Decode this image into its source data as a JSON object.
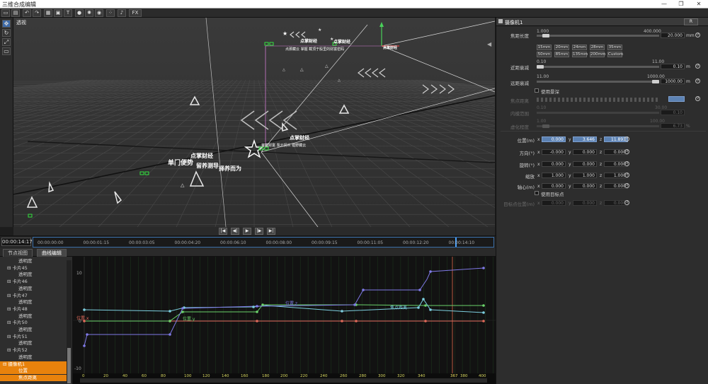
{
  "window": {
    "title": "三维合成编辑",
    "minimize": "—",
    "maximize": "❐",
    "close": "✕"
  },
  "toolbar": {
    "fx_label": "FX"
  },
  "viewport": {
    "label": "透视",
    "texts": [
      "点掌财经",
      "点掌财经",
      "单门便势",
      "留养测导",
      "择养而为",
      "点掌财经",
      "点掌财经",
      "点掌财经"
    ],
    "bg_color": "#303030"
  },
  "playback": {
    "buttons": [
      "|◀",
      "◀|",
      "▶",
      "|▶",
      "▶|"
    ]
  },
  "timeline": {
    "current_time": "00:00:14:17",
    "ticks": [
      "00:00:00:00",
      "00:00:01:15",
      "00:00:03:05",
      "00:00:04:20",
      "00:00:06:10",
      "00:00:08:00",
      "00:00:09:15",
      "00:00:11:05",
      "00:00:12:20",
      "00:00:14:10"
    ]
  },
  "tabs": [
    "节点视图",
    "曲线编辑"
  ],
  "tree": {
    "items": [
      {
        "label": "透明度",
        "indent": 2
      },
      {
        "label": "卡片45",
        "indent": 1
      },
      {
        "label": "透明度",
        "indent": 2
      },
      {
        "label": "卡片46",
        "indent": 1
      },
      {
        "label": "透明度",
        "indent": 2
      },
      {
        "label": "卡片47",
        "indent": 1
      },
      {
        "label": "透明度",
        "indent": 2
      },
      {
        "label": "卡片48",
        "indent": 1
      },
      {
        "label": "透明度",
        "indent": 2
      },
      {
        "label": "卡片50",
        "indent": 1
      },
      {
        "label": "透明度",
        "indent": 2
      },
      {
        "label": "卡片51",
        "indent": 1
      },
      {
        "label": "透明度",
        "indent": 2
      },
      {
        "label": "卡片52",
        "indent": 1
      },
      {
        "label": "透明度",
        "indent": 2
      },
      {
        "label": "摄像机1",
        "indent": 0,
        "selected": true
      },
      {
        "label": "位置",
        "indent": 2,
        "selected": true
      },
      {
        "label": "焦点距离",
        "indent": 2,
        "selected": true
      }
    ]
  },
  "graph": {
    "y_labels": [
      "10",
      "0",
      "-10"
    ],
    "x_labels": [
      "0",
      "20",
      "40",
      "60",
      "80",
      "100",
      "120",
      "140",
      "160",
      "180",
      "200",
      "220",
      "240",
      "260",
      "280",
      "300",
      "320",
      "340",
      "367",
      "380",
      "400"
    ],
    "playhead_label": "367",
    "curve_labels": [
      "位置.x",
      "位置.y",
      "位置.z",
      "焦点距离"
    ],
    "colors": {
      "x": "#e06a5a",
      "y": "#6bd36b",
      "z": "#7f79e6",
      "focus": "#7dcfe0",
      "playhead": "#e0694a"
    }
  },
  "panel": {
    "title": "摄像机1",
    "reset_button": "R",
    "focal": {
      "label": "焦距长度",
      "min": "1.000",
      "max": "400.000",
      "value": "20.000",
      "unit": "mm",
      "slider": 0.05
    },
    "lenses": [
      "15mm",
      "20mm",
      "24mm",
      "28mm",
      "35mm",
      "50mm",
      "85mm",
      "135mm",
      "200mm",
      "Custom"
    ],
    "near": {
      "label": "近距衰减",
      "min": "0.10",
      "max": "11.00",
      "value": "0.10",
      "unit": "m",
      "slider": 0.0
    },
    "far": {
      "label": "远距衰减",
      "min": "11.00",
      "max": "1000.00",
      "value": "1000.00",
      "unit": "m",
      "slider": 1.0
    },
    "dof_label": "使用景深",
    "focus_dist": {
      "label": "焦点距离",
      "value": "",
      "slider": 0.55
    },
    "blur_range": {
      "label": "内模范围",
      "min": "0.10",
      "max": "30.00",
      "value": "0.10"
    },
    "blur_amount": {
      "label": "虚化程度",
      "min": "1.00",
      "max": "100.00",
      "value": "6.73",
      "unit": "%"
    },
    "position": {
      "label": "位置(m)",
      "x": "0.000",
      "y": "3.646",
      "z": "11.893"
    },
    "direction": {
      "label": "方向(°)",
      "x": "-0.000",
      "y": "0.000",
      "z": "0.000"
    },
    "rotation": {
      "label": "旋转(°)",
      "x": "0.000",
      "y": "0.000",
      "z": "0.000"
    },
    "scale": {
      "label": "缩放",
      "x": "1.000",
      "y": "1.000",
      "z": "1.000"
    },
    "pivot": {
      "label": "轴心(m)",
      "x": "0.000",
      "y": "0.000",
      "z": "0.000"
    },
    "target_label": "使用目标点",
    "target_pos": {
      "label": "目标点位置(m)",
      "x": "0.000",
      "y": "0.000",
      "z": "0.000"
    },
    "axis": {
      "x": "x",
      "y": "y",
      "z": "z"
    }
  }
}
